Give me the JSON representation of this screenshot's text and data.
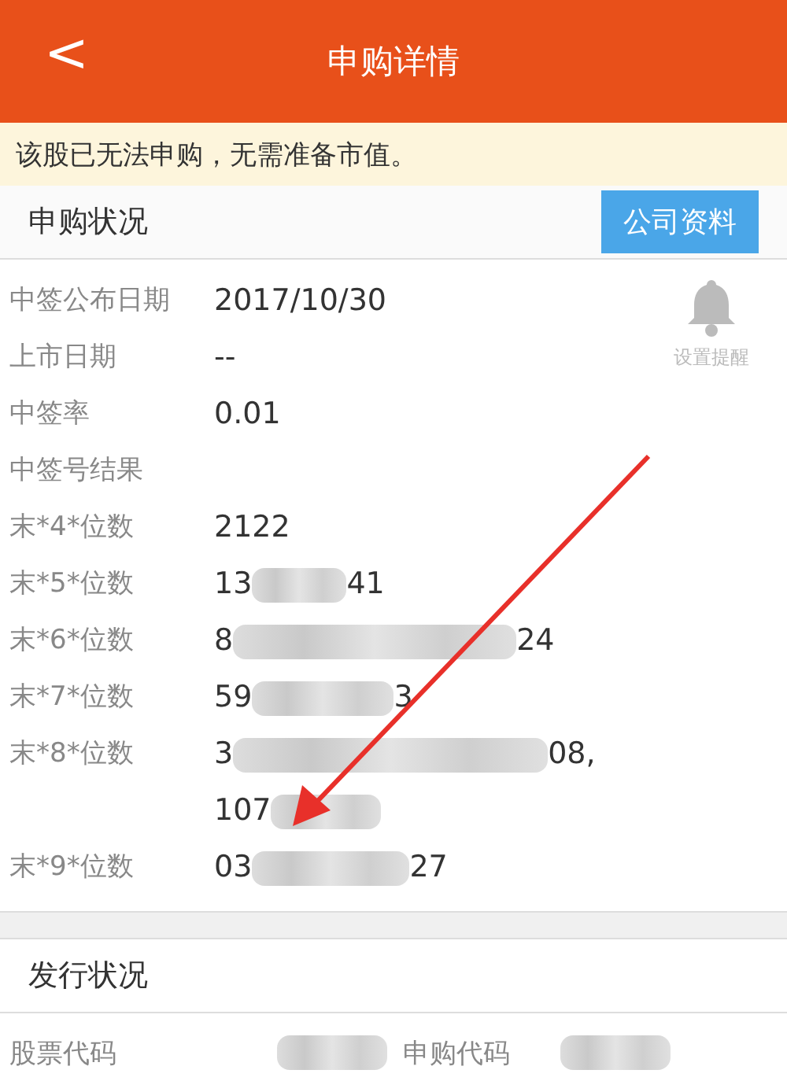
{
  "header": {
    "back": "<",
    "title": "申购详情"
  },
  "notice": "该股已无法申购，无需准备市值。",
  "subscription": {
    "title": "申购状况",
    "button": "公司资料",
    "reminder": {
      "label": "设置提醒",
      "on": false
    },
    "rows": [
      {
        "label": "中签公布日期",
        "parts": [
          {
            "kind": "text",
            "text": "2017/10/30"
          }
        ]
      },
      {
        "label": "上市日期",
        "parts": [
          {
            "kind": "text",
            "text": "--"
          }
        ]
      },
      {
        "label": "中签率",
        "parts": [
          {
            "kind": "text",
            "text": "0.01"
          }
        ]
      },
      {
        "label": "中签号结果",
        "parts": []
      },
      {
        "label": "末*4*位数",
        "parts": [
          {
            "kind": "text",
            "text": "2122"
          }
        ]
      },
      {
        "label": "末*5*位数",
        "parts": [
          {
            "kind": "text",
            "text": "13"
          },
          {
            "kind": "redacted"
          },
          {
            "kind": "text",
            "text": "41"
          }
        ]
      },
      {
        "label": "末*6*位数",
        "parts": [
          {
            "kind": "text",
            "text": "8"
          },
          {
            "kind": "redacted"
          },
          {
            "kind": "text",
            "text": "24"
          }
        ]
      },
      {
        "label": "末*7*位数",
        "parts": [
          {
            "kind": "text",
            "text": "59"
          },
          {
            "kind": "redacted"
          },
          {
            "kind": "text",
            "text": "3"
          }
        ]
      },
      {
        "label": "末*8*位数",
        "parts": [
          {
            "kind": "text",
            "text": "3"
          },
          {
            "kind": "redacted"
          },
          {
            "kind": "text",
            "text": "08,"
          },
          {
            "kind": "break"
          },
          {
            "kind": "text",
            "text": "107"
          },
          {
            "kind": "redacted"
          }
        ]
      },
      {
        "label": "末*9*位数",
        "parts": [
          {
            "kind": "text",
            "text": "03"
          },
          {
            "kind": "redacted"
          },
          {
            "kind": "text",
            "text": "27"
          }
        ]
      }
    ]
  },
  "issue": {
    "title": "发行状况",
    "fields": [
      {
        "label": "股票代码",
        "redacted": true
      },
      {
        "label": "申购代码",
        "redacted": true
      }
    ]
  }
}
